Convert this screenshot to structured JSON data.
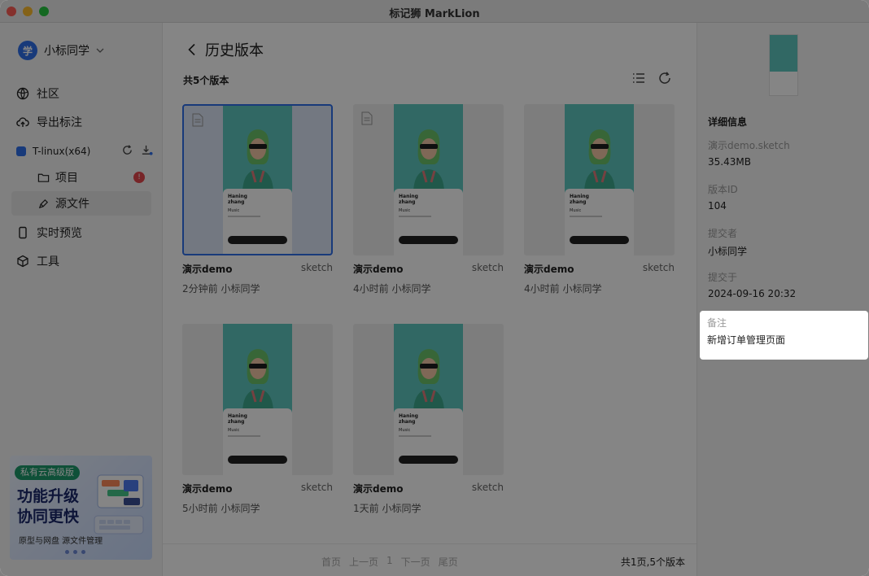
{
  "window": {
    "title": "标记狮 MarkLion"
  },
  "sidebar": {
    "user": {
      "avatar_text": "学",
      "name": "小标同学"
    },
    "nav": [
      {
        "label": "社区",
        "icon": "globe-icon"
      },
      {
        "label": "导出标注",
        "icon": "cloud-upload-icon"
      }
    ],
    "project": {
      "name": "T-linux(x64)",
      "color": "#2f6fea",
      "items": [
        {
          "label": "项目",
          "icon": "folder-icon",
          "badge": "!"
        },
        {
          "label": "源文件",
          "icon": "pen-icon",
          "active": true
        }
      ]
    },
    "nav_bottom": [
      {
        "label": "实时预览",
        "icon": "phone-icon"
      },
      {
        "label": "工具",
        "icon": "cube-icon"
      }
    ],
    "promo": {
      "tag": "私有云高级版",
      "title": "功能升级 协同更快",
      "subtitle": "原型与网盘   源文件管理"
    }
  },
  "main": {
    "title": "历史版本",
    "count_label": "共5个版本",
    "versions": [
      {
        "name": "演示demo",
        "ext": "sketch",
        "meta": "2分钟前 小标同学",
        "selected": true,
        "has_doc_icon": true
      },
      {
        "name": "演示demo",
        "ext": "sketch",
        "meta": "4小时前 小标同学",
        "selected": false,
        "has_doc_icon": true
      },
      {
        "name": "演示demo",
        "ext": "sketch",
        "meta": "4小时前 小标同学",
        "selected": false,
        "has_doc_icon": false
      },
      {
        "name": "演示demo",
        "ext": "sketch",
        "meta": "5小时前 小标同学",
        "selected": false,
        "has_doc_icon": false
      },
      {
        "name": "演示demo",
        "ext": "sketch",
        "meta": "1天前 小标同学",
        "selected": false,
        "has_doc_icon": false
      }
    ],
    "thumbnail": {
      "name_line1": "Haning",
      "name_line2": "zhang",
      "music": "Music"
    },
    "pager": {
      "first": "首页",
      "prev": "上一页",
      "page": "1",
      "next": "下一页",
      "last": "尾页",
      "total": "共1页,5个版本"
    }
  },
  "details": {
    "title": "详细信息",
    "file_name": "演示demo.sketch",
    "file_size": "35.43MB",
    "version_id_label": "版本ID",
    "version_id": "104",
    "submitter_label": "提交者",
    "submitter": "小标同学",
    "submitted_at_label": "提交于",
    "submitted_at": "2024-09-16 20:32",
    "note_label": "备注",
    "note": "新增订单管理页面"
  },
  "colors": {
    "accent": "#2f6fea",
    "badge": "#e5484d",
    "promo_tag": "#1d9a6c",
    "thumb_teal": "#5fc8c0"
  }
}
